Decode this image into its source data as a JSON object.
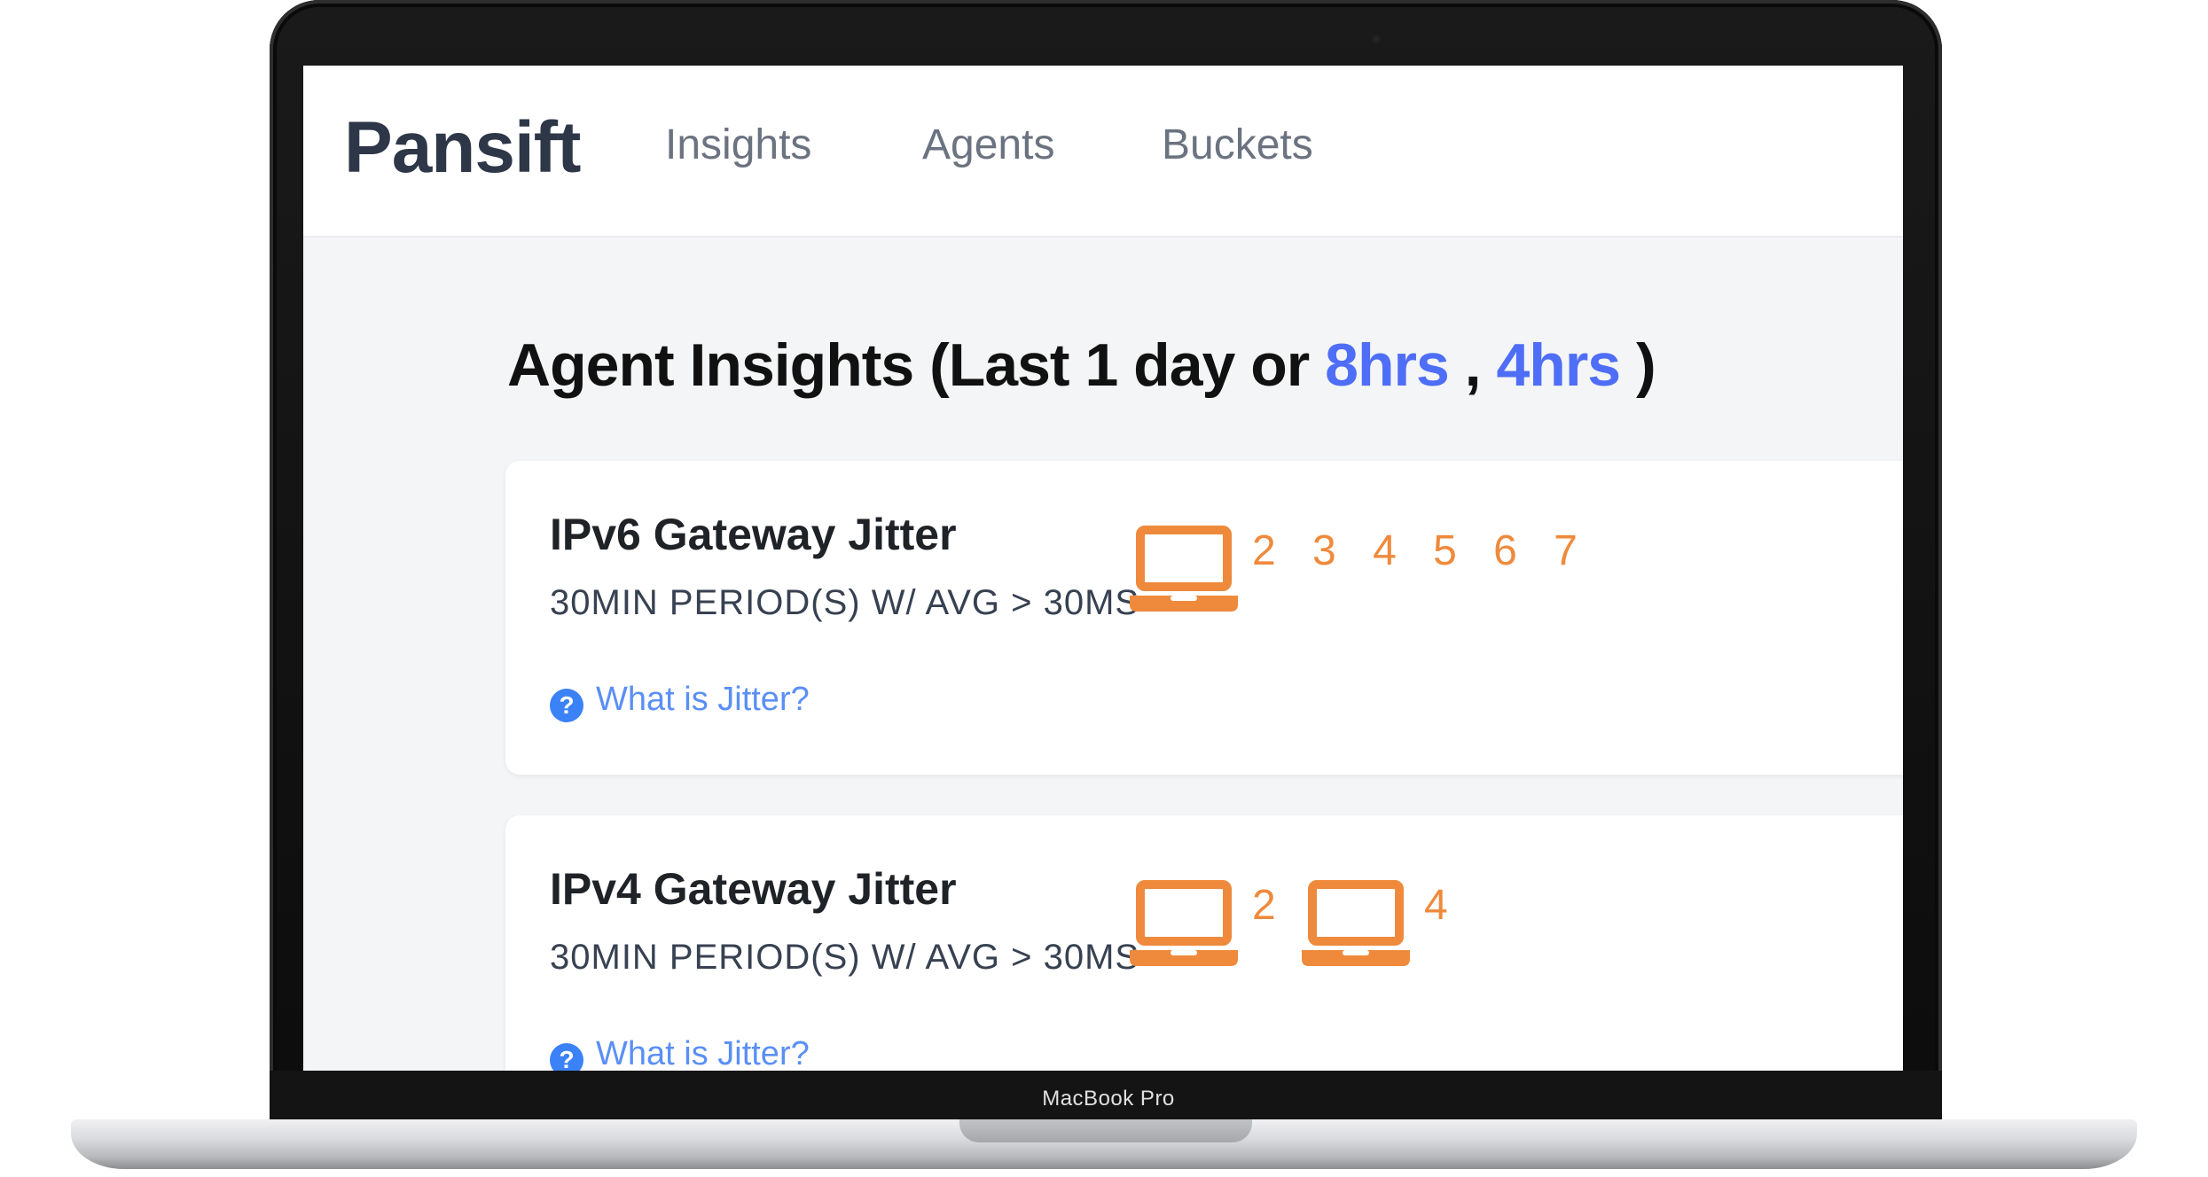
{
  "device": {
    "model_label": "MacBook Pro"
  },
  "nav": {
    "brand": "Pansift",
    "links": [
      "Insights",
      "Agents",
      "Buckets"
    ]
  },
  "page": {
    "title_prefix": "Agent Insights (Last 1 day or ",
    "range_8": "8hrs",
    "separator": " , ",
    "range_4": "4hrs",
    "title_suffix": " )"
  },
  "cards": [
    {
      "title": "IPv6 Gateway Jitter",
      "description": "30MIN PERIOD(S) W/ AVG > 30MS",
      "help_text": "What is Jitter?",
      "agent_groups": [
        {
          "icon": "laptop-icon",
          "ids": "2 3 4 5 6 7"
        }
      ]
    },
    {
      "title": "IPv4 Gateway Jitter",
      "description": "30MIN PERIOD(S) W/ AVG > 30MS",
      "help_text": "What is Jitter?",
      "agent_groups": [
        {
          "icon": "laptop-icon",
          "ids": "2"
        },
        {
          "icon": "laptop-icon",
          "ids": "4"
        }
      ]
    }
  ],
  "colors": {
    "brand": "#2d3748",
    "accent_link": "#4f6ef7",
    "help_link": "#5a8ff5",
    "agent_orange": "#ef8a3c",
    "background": "#f4f5f6"
  }
}
